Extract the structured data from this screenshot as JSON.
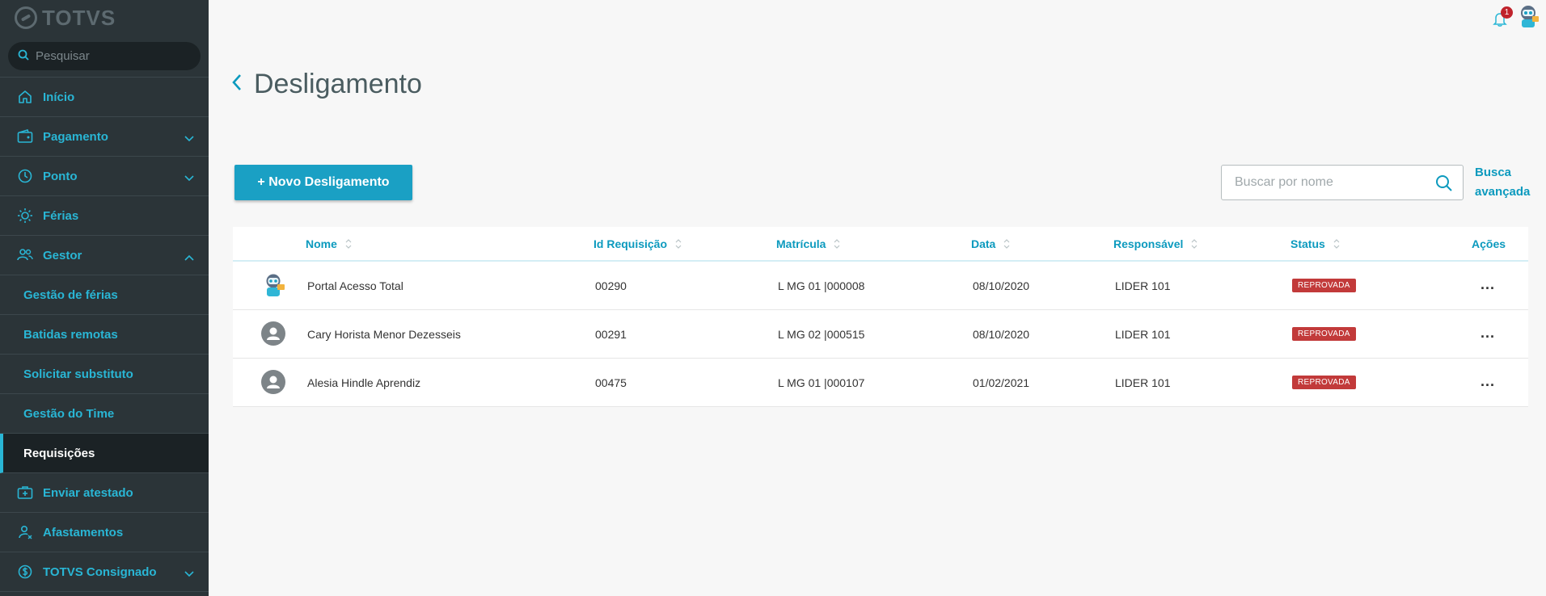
{
  "app": {
    "logo_text": "TOTVS"
  },
  "sidebar": {
    "search_placeholder": "Pesquisar",
    "items": [
      {
        "label": "Início"
      },
      {
        "label": "Pagamento"
      },
      {
        "label": "Ponto"
      },
      {
        "label": "Férias"
      },
      {
        "label": "Gestor"
      },
      {
        "label": "Gestão de férias"
      },
      {
        "label": "Batidas remotas"
      },
      {
        "label": "Solicitar substituto"
      },
      {
        "label": "Gestão do Time"
      },
      {
        "label": "Requisições"
      },
      {
        "label": "Enviar atestado"
      },
      {
        "label": "Afastamentos"
      },
      {
        "label": "TOTVS Consignado"
      }
    ]
  },
  "header": {
    "notification_count": "1"
  },
  "page": {
    "title": "Desligamento",
    "new_button": "+ Novo Desligamento",
    "search_placeholder": "Buscar por nome",
    "advanced_search_line1": "Busca",
    "advanced_search_line2": "avançada"
  },
  "table": {
    "columns": [
      "Nome",
      "Id Requisição",
      "Matrícula",
      "Data",
      "Responsável",
      "Status",
      "Ações"
    ],
    "rows": [
      {
        "nome": "Portal Acesso Total",
        "id": "00290",
        "matricula": "L MG 01 |000008",
        "data": "08/10/2020",
        "responsavel": "LIDER 101",
        "status": "REPROVADA",
        "acoes": "..."
      },
      {
        "nome": "Cary Horista Menor Dezesseis",
        "id": "00291",
        "matricula": "L MG 02 |000515",
        "data": "08/10/2020",
        "responsavel": "LIDER 101",
        "status": "REPROVADA",
        "acoes": "..."
      },
      {
        "nome": "Alesia Hindle Aprendiz",
        "id": "00475",
        "matricula": "L MG 01 |000107",
        "data": "01/02/2021",
        "responsavel": "LIDER 101",
        "status": "REPROVADA",
        "acoes": "..."
      }
    ]
  },
  "colors": {
    "accent": "#29b6d5",
    "primary_button": "#1aa0c4",
    "sidebar_bg": "#2b3438",
    "status_rejected": "#c23a3a"
  }
}
